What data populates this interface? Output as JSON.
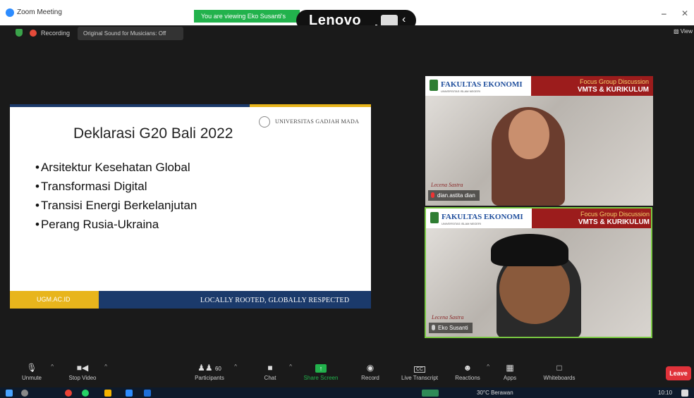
{
  "titlebar": {
    "app_title": "Zoom Meeting",
    "viewing_banner": "You are viewing Eko Susanti's",
    "brand": "Lenovo",
    "minimize_glyph": "–",
    "close_glyph": "✕"
  },
  "meeting_header": {
    "recording_label": "Recording",
    "original_sound": "Original Sound for Musicians: Off",
    "view_label": "View"
  },
  "slide": {
    "university": "UNIVERSITAS GADJAH MADA",
    "title": "Deklarasi G20 Bali 2022",
    "bullets": [
      "Arsitektur Kesehatan Global",
      "Transformasi Digital",
      "Transisi Energi Berkelanjutan",
      "Perang Rusia-Ukraina"
    ],
    "footer_left": "UGM.AC.ID",
    "footer_tagline": "LOCALLY ROOTED, GLOBALLY RESPECTED"
  },
  "video_tiles": [
    {
      "org": "FAKULTAS EKONOMI",
      "org_sub": "UNIVERSITAS ISLAM NEGERI",
      "event_line1": "Focus Group Discussion",
      "event_line2": "VMTS & KURIKULUM",
      "signature": "Lecena Sastra",
      "participant": "dian.astita dian"
    },
    {
      "org": "FAKULTAS EKONOMI",
      "org_sub": "UNIVERSITAS ISLAM NEGERI",
      "event_line1": "Focus Group Discussion",
      "event_line2": "VMTS & KURIKULUM",
      "signature": "Lecena Sastra",
      "participant": "Eko Susanti"
    }
  ],
  "toolbar": {
    "unmute": "Unmute",
    "stop_video": "Stop Video",
    "participants": "Participants",
    "participants_count": "60",
    "chat": "Chat",
    "share_screen": "Share Screen",
    "record": "Record",
    "live_transcript": "Live Transcript",
    "reactions": "Reactions",
    "apps": "Apps",
    "whiteboards": "Whiteboards",
    "leave": "Leave",
    "cc_glyph": "CC",
    "share_glyph": "↑"
  },
  "taskbar": {
    "weather": "30°C  Berawan",
    "time": "10:10"
  },
  "colors": {
    "zoom_blue": "#2d8cff",
    "share_green": "#22b24c",
    "leave_red": "#e0323a",
    "ugm_navy": "#1b3a6b",
    "ugm_gold": "#e8b51c",
    "active_speaker_border": "#7ac943"
  }
}
